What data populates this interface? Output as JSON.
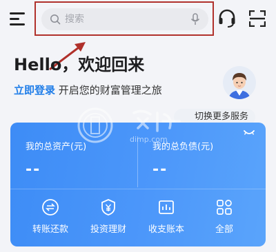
{
  "topbar": {
    "search_placeholder": "搜索",
    "menu_icon": "menu-icon",
    "search_icon": "search-icon",
    "mic_icon": "microphone-icon",
    "support_icon": "headset-icon",
    "scan_icon": "scan-icon"
  },
  "greeting": {
    "title": "Hello，欢迎回来",
    "login_link": "立即登录",
    "subtitle": "开启您的财富管理之旅"
  },
  "switch_service": "切换更多服务",
  "account_card": {
    "total_assets_label": "我的总资产(元)",
    "total_assets_value": "--",
    "total_liabilities_label": "我的总负债(元)",
    "total_liabilities_value": "--",
    "quick_actions": [
      {
        "label": "转账还款",
        "icon": "transfer-icon"
      },
      {
        "label": "投资理财",
        "icon": "invest-shield-icon"
      },
      {
        "label": "收支账本",
        "icon": "ledger-icon"
      },
      {
        "label": "全部",
        "icon": "grid-icon"
      }
    ]
  },
  "watermark_text": "dimp.com",
  "colors": {
    "accent": "#1f7de8",
    "card_start": "#3d8cf6",
    "card_end": "#5aa4fb",
    "annotation": "#b0302b",
    "page_bg": "#f3f4f8"
  }
}
